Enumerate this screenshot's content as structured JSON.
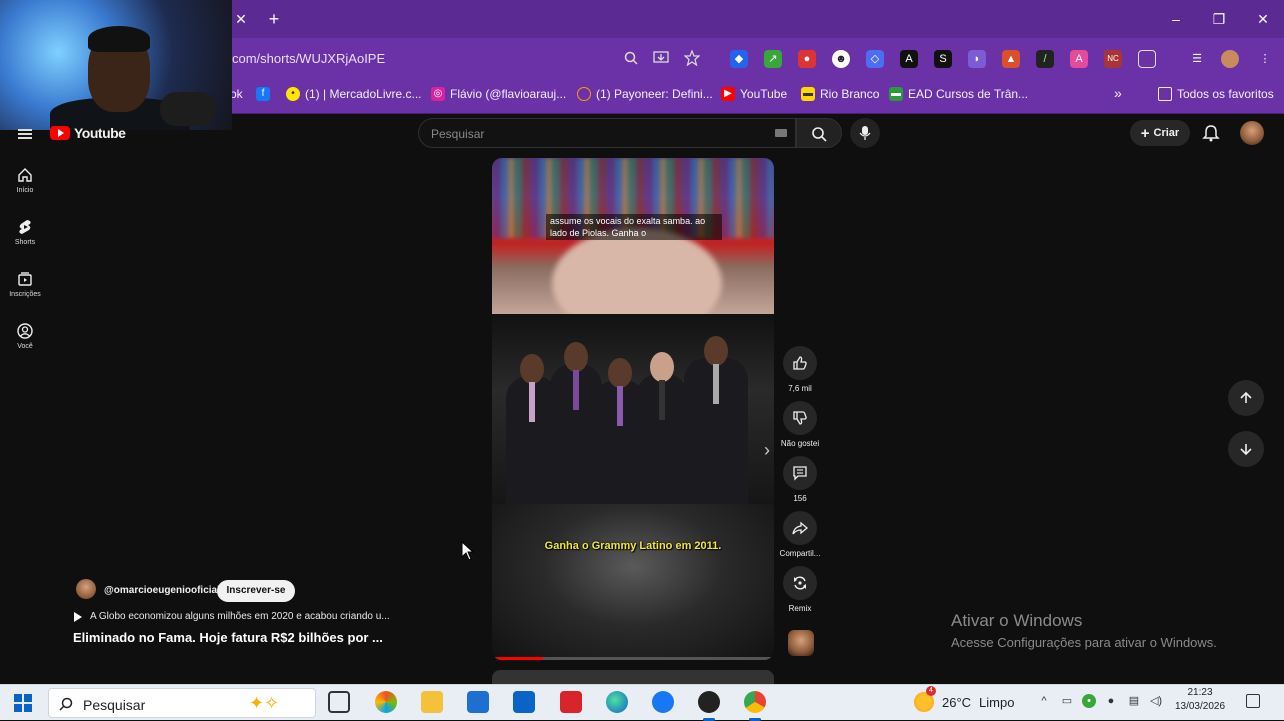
{
  "browser": {
    "url": "com/shorts/WUJXRjAoIPE",
    "new_tab": "+",
    "close_tab": "✕",
    "bookmarks": [
      {
        "label": "ok",
        "icon": "folder-icon"
      },
      {
        "label": "",
        "icon": "facebook-icon"
      },
      {
        "label": "(1) | MercadoLivre.c...",
        "icon": "mercadolivre-icon"
      },
      {
        "label": "Flávio (@flavioarauj...",
        "icon": "instagram-icon"
      },
      {
        "label": "(1) Payoneer: Defini...",
        "icon": "payoneer-icon"
      },
      {
        "label": "YouTube",
        "icon": "youtube-icon"
      },
      {
        "label": "Rio Branco",
        "icon": "bank-icon"
      },
      {
        "label": "EAD Cursos de Trân...",
        "icon": "ead-icon"
      }
    ],
    "more_bookmarks": "»",
    "all_bookmarks": "Todos os favoritos"
  },
  "youtube": {
    "logo": "Youtube",
    "search_placeholder": "Pesquisar",
    "create_label": "Criar",
    "sidebar": [
      {
        "label": "Início",
        "icon": "home-icon"
      },
      {
        "label": "Shorts",
        "icon": "shorts-icon"
      },
      {
        "label": "Inscrições",
        "icon": "subscriptions-icon"
      },
      {
        "label": "Você",
        "icon": "you-icon"
      }
    ],
    "short": {
      "caption_top": "assume os vocais do exalta samba. ao lado de Piolas. Ganha o",
      "caption_bottom": "Ganha o Grammy Latino em 2011.",
      "progress": 0.18,
      "channel": "@omarcioeugeniooficial",
      "subscribe_label": "Inscrever-se",
      "music": "A Globo economizou alguns milhões em 2020 e acabou criando u...",
      "title": "Eliminado no Fama. Hoje fatura R$2 bilhões por ..."
    },
    "actions": [
      {
        "label": "7,6 mil",
        "icon": "like-icon"
      },
      {
        "label": "Não gostei",
        "icon": "dislike-icon"
      },
      {
        "label": "156",
        "icon": "comment-icon"
      },
      {
        "label": "Compartil...",
        "icon": "share-icon"
      },
      {
        "label": "Remix",
        "icon": "remix-icon"
      }
    ]
  },
  "windows": {
    "activate_title": "Ativar o Windows",
    "activate_sub": "Acesse Configurações para ativar o Windows."
  },
  "taskbar": {
    "search_label": "Pesquisar",
    "weather_temp": "26°C",
    "weather_desc": "Limpo",
    "weather_badge": "4",
    "time": "21:23",
    "date": "13/03/2026"
  },
  "colors": {
    "chrome_tabs": "#5c2a93",
    "chrome_bar": "#6a32a6",
    "youtube_bg": "#0f0f0f",
    "youtube_red": "#ff0000"
  }
}
